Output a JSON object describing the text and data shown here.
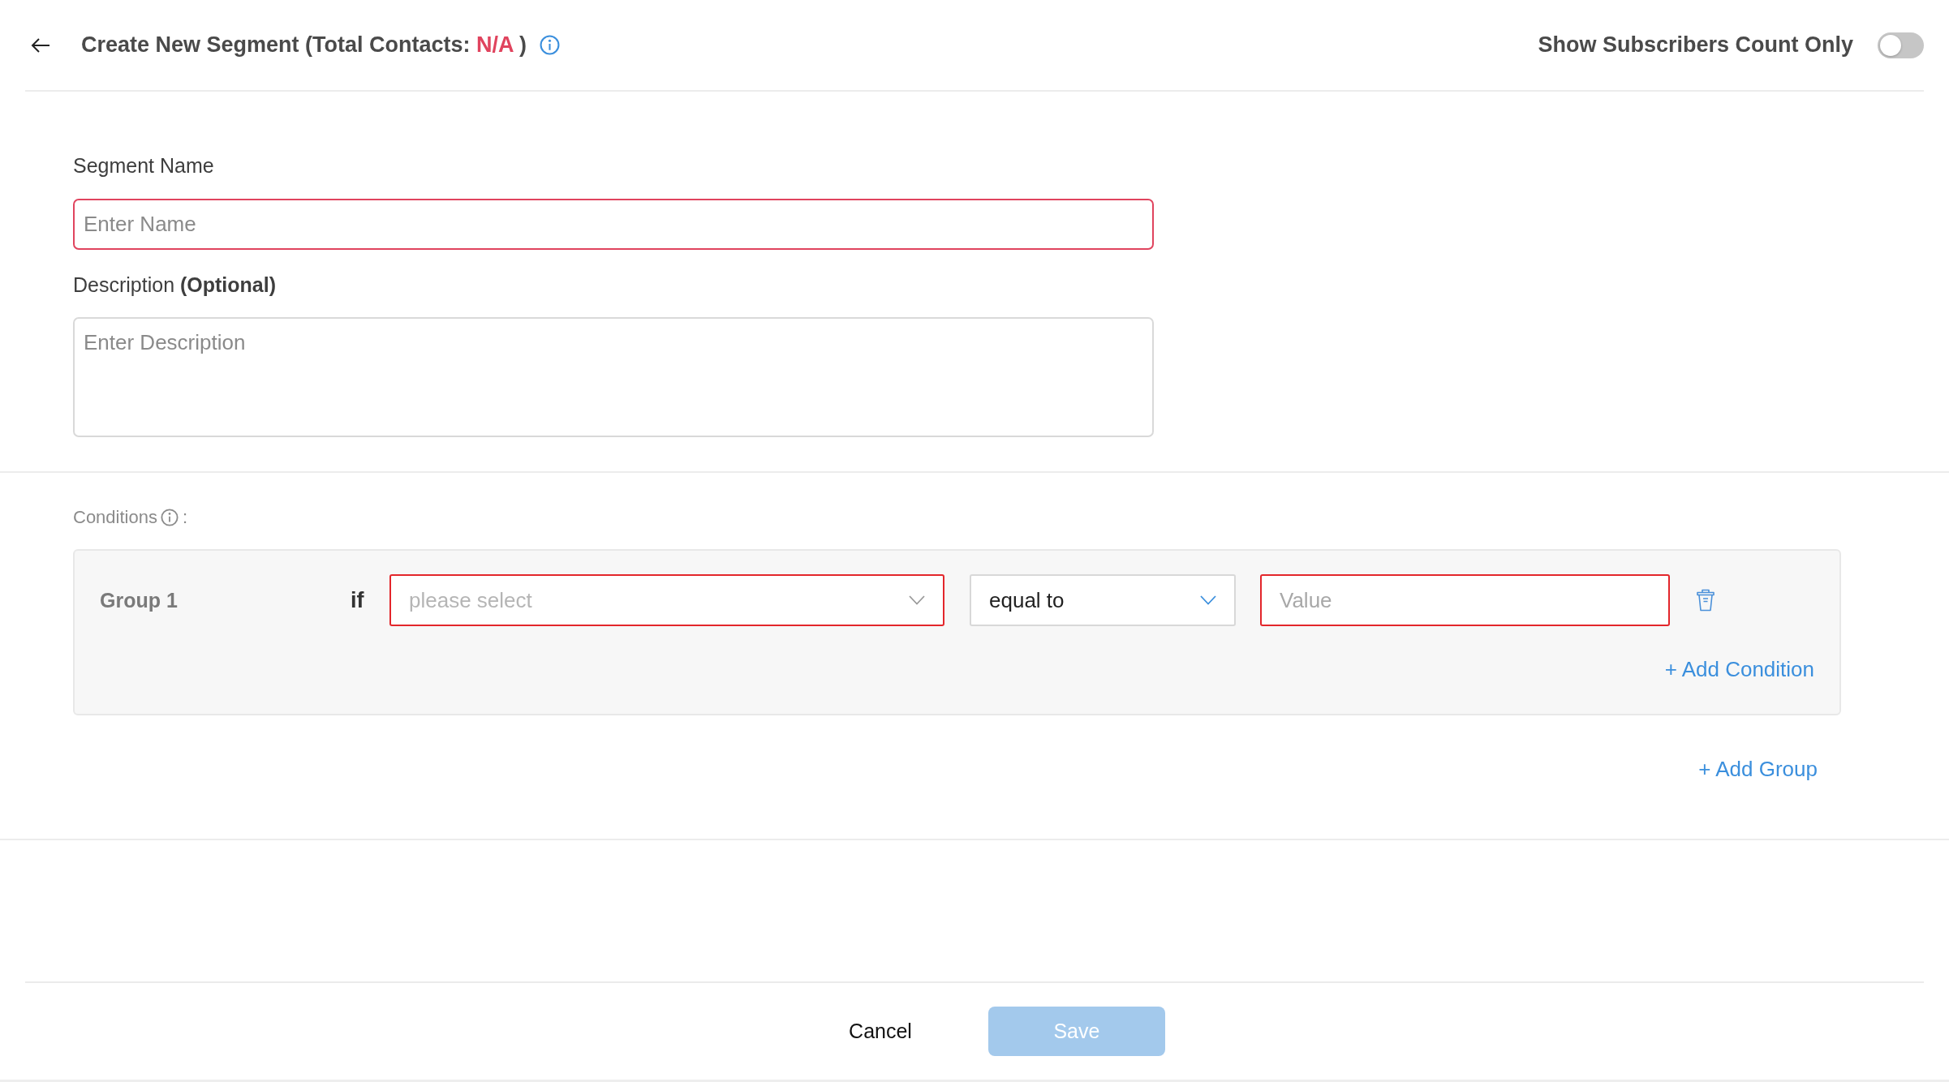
{
  "header": {
    "title": "Create New Segment (Total Contacts:",
    "total_contacts": "N/A",
    "title_end": ")"
  },
  "toggle": {
    "label": "Show Subscribers Count Only",
    "on": false
  },
  "fields": [
    {
      "kind": "input",
      "label": "Segment Name",
      "placeholder": "Enter Name",
      "error": true
    },
    {
      "kind": "textarea",
      "label": "Description **(Optional)**",
      "placeholder": "Enter Description",
      "error": false
    }
  ],
  "conditions": {
    "label": "Conditions",
    "suffix": ":",
    "groups": [
      {
        "name": "Group 1",
        "rows": [
          {
            "connector": "if",
            "field": {
              "placeholder": "please select",
              "error": true
            },
            "operator": {
              "value": "equal to",
              "error": false
            },
            "value": {
              "placeholder": "Value",
              "error": true
            }
          }
        ],
        "add_condition": "+ Add Condition"
      }
    ],
    "add_group": "+ Add Group"
  },
  "footer": {
    "cancel": "Cancel",
    "save": {
      "label": "Save",
      "disabled": true
    }
  }
}
